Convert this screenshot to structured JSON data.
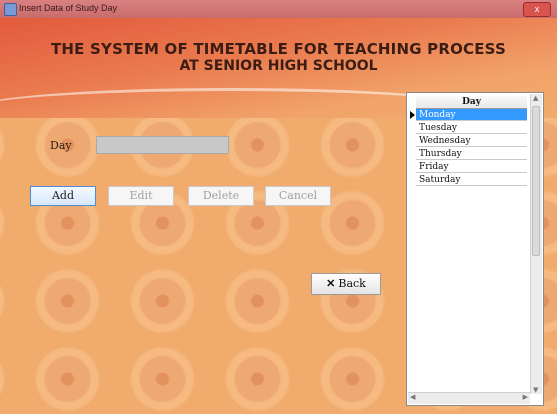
{
  "window": {
    "title": "Insert Data of Study Day",
    "close_label": "x"
  },
  "header": {
    "line1": "THE SYSTEM OF TIMETABLE FOR TEACHING PROCESS",
    "line2": "AT SENIOR HIGH SCHOOL"
  },
  "form": {
    "day_label": "Day",
    "day_value": ""
  },
  "buttons": {
    "add": "Add",
    "edit": "Edit",
    "delete": "Delete",
    "cancel": "Cancel",
    "back": "Back",
    "back_icon": "✕"
  },
  "grid": {
    "column_header": "Day",
    "rows": [
      "Monday",
      "Tuesday",
      "Wednesday",
      "Thursday",
      "Friday",
      "Saturday"
    ],
    "selected_index": 0
  },
  "colors": {
    "form_background": "#f1ab6c",
    "header_red": "#e25a3c",
    "selection": "#3399ff"
  }
}
